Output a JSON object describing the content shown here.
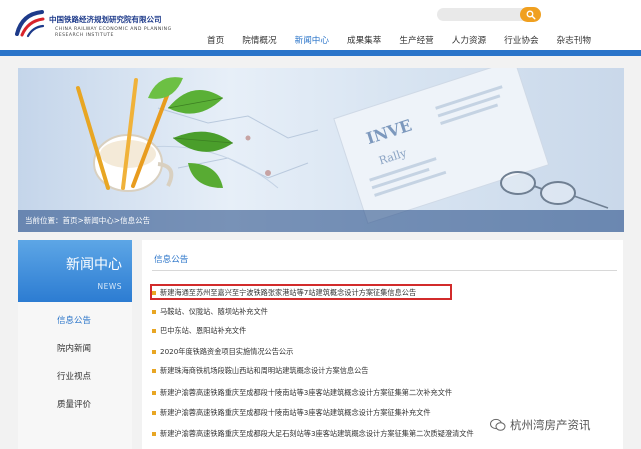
{
  "header": {
    "org_name_cn": "中国铁路经济规划研究院有限公司",
    "org_name_en_1": "CHINA RAILWAY ECONOMIC AND PLANNING",
    "org_name_en_2": "RESEARCH INSTITUTE",
    "search": {
      "placeholder": ""
    }
  },
  "nav": {
    "items": [
      "首页",
      "院情概况",
      "新闻中心",
      "成果集萃",
      "生产经营",
      "人力资源",
      "行业协会",
      "杂志刊物"
    ],
    "active": "新闻中心"
  },
  "banner": {
    "breadcrumb": "当前位置：首页>新闻中心>信息公告"
  },
  "sidebar": {
    "title": "新闻中心",
    "subtitle": "NEWS",
    "items": [
      "信息公告",
      "院内新闻",
      "行业视点",
      "质量评价"
    ]
  },
  "content": {
    "title": "信息公告",
    "items": [
      "新建海通至苏州至嘉兴至宁波铁路张家港站等7站建筑概念设计方案征集信息公告",
      "马鞍站、仪陇站、随坝站补充文件",
      "巴中东站、恩阳站补充文件",
      "2020年度铁路资金项目实施情况公告公示",
      "新建珠海商铁机场段鞍山西站和周明站建筑概念设计方案信息公告",
      "新建沪渝蓉高速铁路重庆至成都段十陵南站等3座客站建筑概念设计方案征集第二次补充文件",
      "新建沪渝蓉高速铁路重庆至成都段十陵南站等3座客站建筑概念设计方案征集补充文件",
      "新建沪渝蓉高速铁路重庆至成都段大足石刻站等3座客站建筑概念设计方案征集第二次质疑澄清文件"
    ]
  },
  "watermark": {
    "text": "杭州湾房产资讯"
  },
  "colors": {
    "accent": "#2a74c9",
    "bullet": "#e8a623",
    "highlight": "#d22b2b",
    "search_button": "#f0a020"
  }
}
